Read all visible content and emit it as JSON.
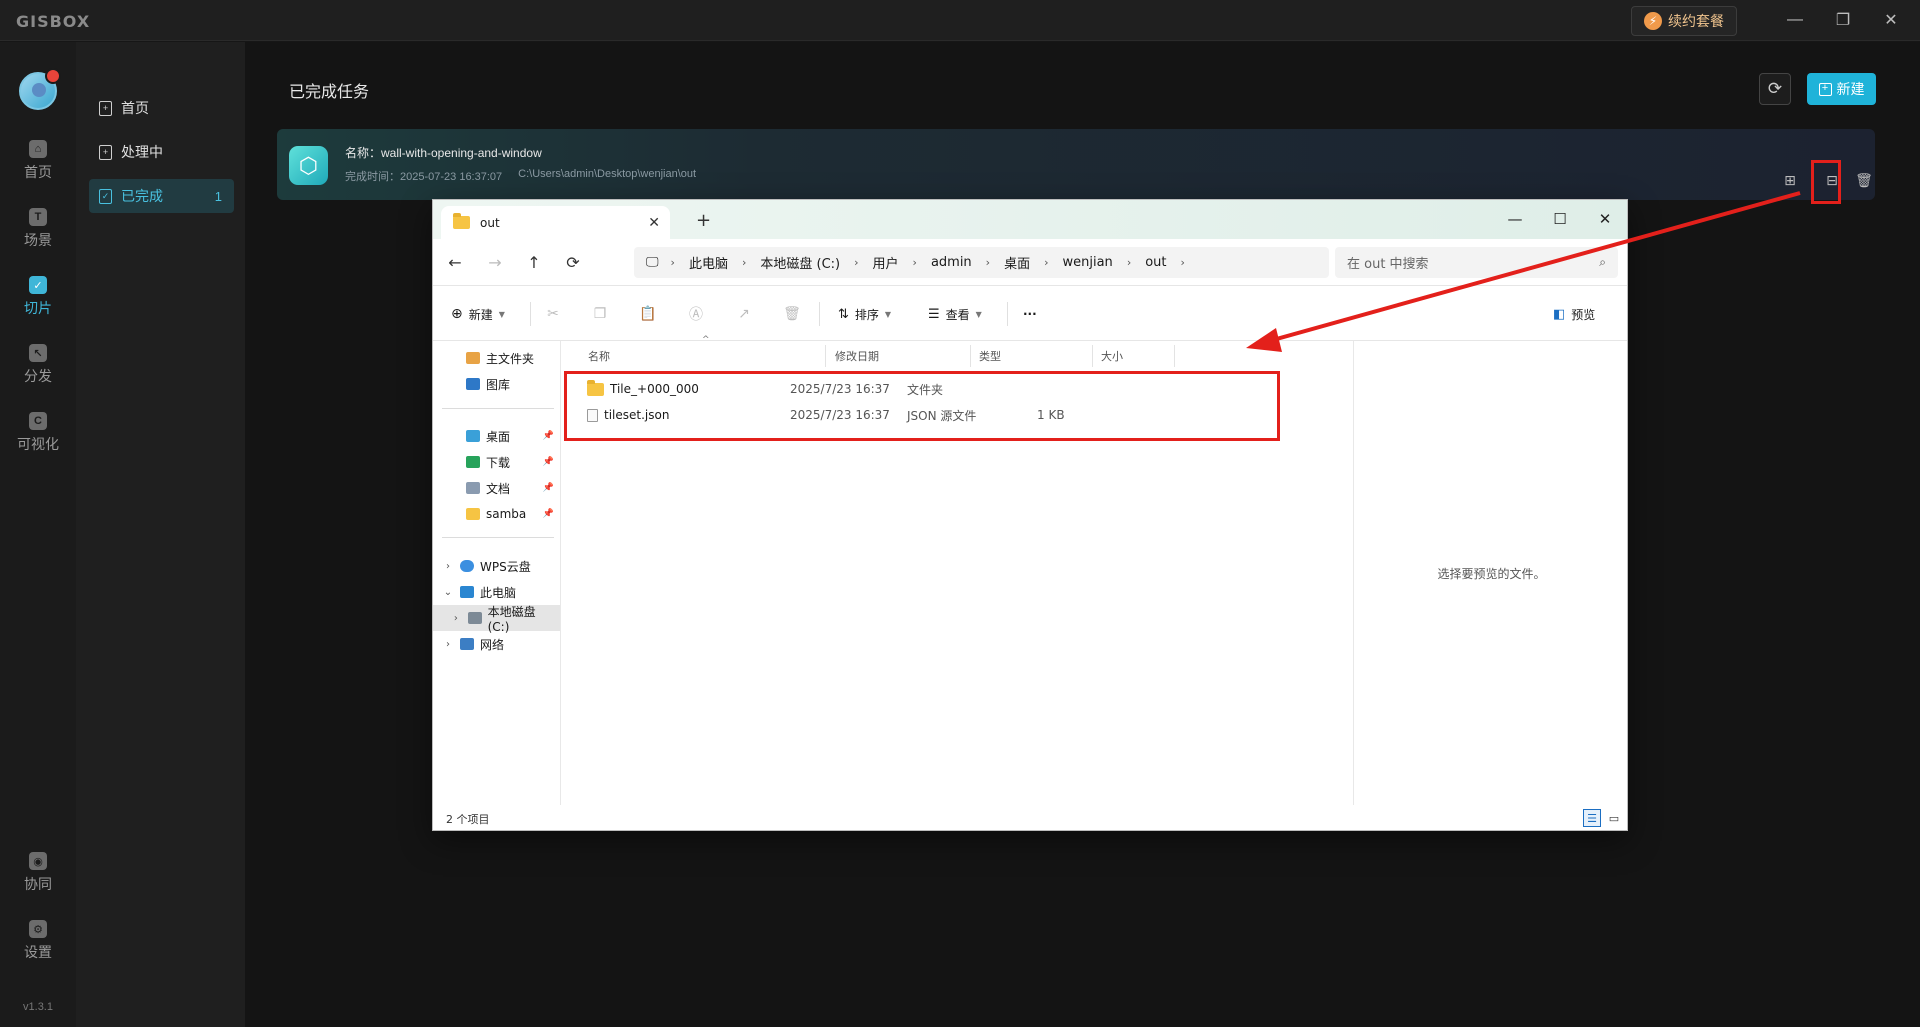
{
  "app": {
    "logo": "GISBOX",
    "renew_label": "续约套餐",
    "version": "v1.3.1"
  },
  "rail": {
    "items": [
      {
        "label": "首页",
        "icon": "home-icon"
      },
      {
        "label": "场景",
        "icon": "scene-icon"
      },
      {
        "label": "切片",
        "icon": "slice-icon"
      },
      {
        "label": "分发",
        "icon": "distribute-icon"
      },
      {
        "label": "可视化",
        "icon": "visualization-icon"
      }
    ],
    "bottom": [
      {
        "label": "协同",
        "icon": "collab-icon"
      },
      {
        "label": "设置",
        "icon": "settings-icon"
      }
    ]
  },
  "subnav": {
    "items": [
      {
        "label": "首页"
      },
      {
        "label": "处理中"
      },
      {
        "label": "已完成",
        "count": "1"
      }
    ]
  },
  "main": {
    "title": "已完成任务",
    "new_label": "新建"
  },
  "task": {
    "name": "名称：wall-with-opening-and-window",
    "time": "完成时间：2025-07-23 16:37:07",
    "path": "C:\\Users\\admin\\Desktop\\wenjian\\out"
  },
  "explorer": {
    "tab_title": "out",
    "breadcrumb": [
      "此电脑",
      "本地磁盘 (C:)",
      "用户",
      "admin",
      "桌面",
      "wenjian",
      "out"
    ],
    "search_placeholder": "在 out 中搜索",
    "cmd": {
      "new": "新建",
      "sort": "排序",
      "view": "查看",
      "more": "···",
      "preview": "预览"
    },
    "nav": {
      "home": "主文件夹",
      "gallery": "图库",
      "desktop": "桌面",
      "downloads": "下载",
      "documents": "文档",
      "samba": "samba",
      "wps": "WPS云盘",
      "this_pc": "此电脑",
      "local_disk": "本地磁盘 (C:)",
      "network": "网络"
    },
    "columns": [
      "名称",
      "修改日期",
      "类型",
      "大小"
    ],
    "files": [
      {
        "name": "Tile_+000_000",
        "date": "2025/7/23 16:37",
        "type": "文件夹",
        "size": "",
        "kind": "folder"
      },
      {
        "name": "tileset.json",
        "date": "2025/7/23 16:37",
        "type": "JSON 源文件",
        "size": "1 KB",
        "kind": "file"
      }
    ],
    "preview_empty": "选择要预览的文件。",
    "status": "2 个项目"
  },
  "colors": {
    "accent": "#1fb3d9",
    "annotation": "#e3201b"
  }
}
